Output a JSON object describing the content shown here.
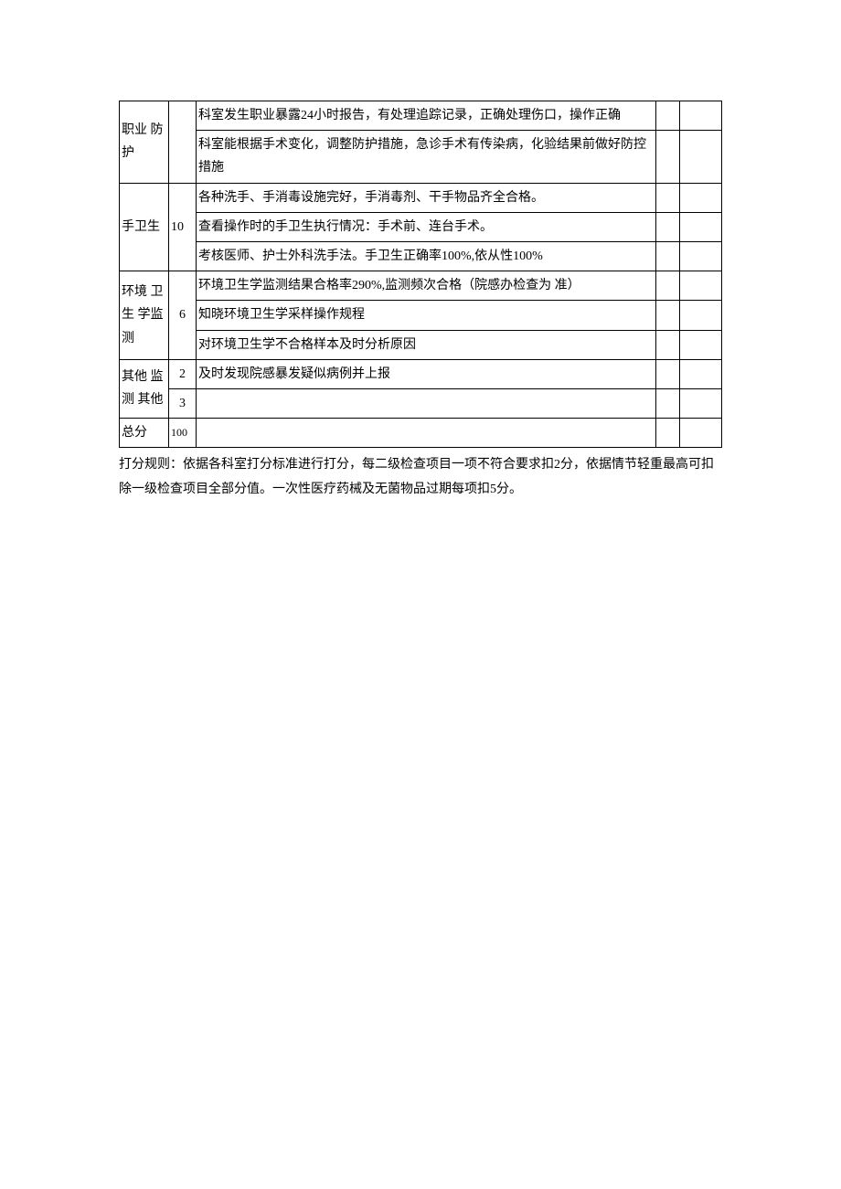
{
  "table": {
    "rows": [
      {
        "category": "职业 防 护",
        "score": "",
        "desc": "科室发生职业暴露24小时报告，有处理追踪记录，正确处理伤口，操作正确"
      },
      {
        "desc": "科室能根据手术变化，调整防护措施，急诊手术有传染病，化验结果前做好防控措施"
      },
      {
        "category": "手卫生",
        "score": "10",
        "desc": "各种洗手、手消毒设施完好，手消毒剂、干手物品齐全合格。"
      },
      {
        "desc": "查看操作时的手卫生执行情况：手术前、连台手术。"
      },
      {
        "desc": "考核医师、护士外科洗手法。手卫生正确率100%,依从性100%"
      },
      {
        "category": "环境 卫生 学监测",
        "score": "6",
        "desc": "环境卫生学监测结果合格率290%,监测频次合格（院感办检查为 准）"
      },
      {
        "desc": "知晓环境卫生学采样操作规程"
      },
      {
        "desc": "对环境卫生学不合格样本及时分析原因"
      },
      {
        "category": "其他 监测 其他",
        "score": "2",
        "desc": "及时发现院感暴发疑似病例并上报"
      },
      {
        "score": "3",
        "desc": ""
      },
      {
        "category": "总分",
        "score": "100",
        "desc": ""
      }
    ]
  },
  "footer_note": "打分规则：依据各科室打分标准进行打分，每二级检查项目一项不符合要求扣2分，依据情节轻重最高可扣除一级检查项目全部分值。一次性医疗药械及无菌物品过期每项扣5分。"
}
